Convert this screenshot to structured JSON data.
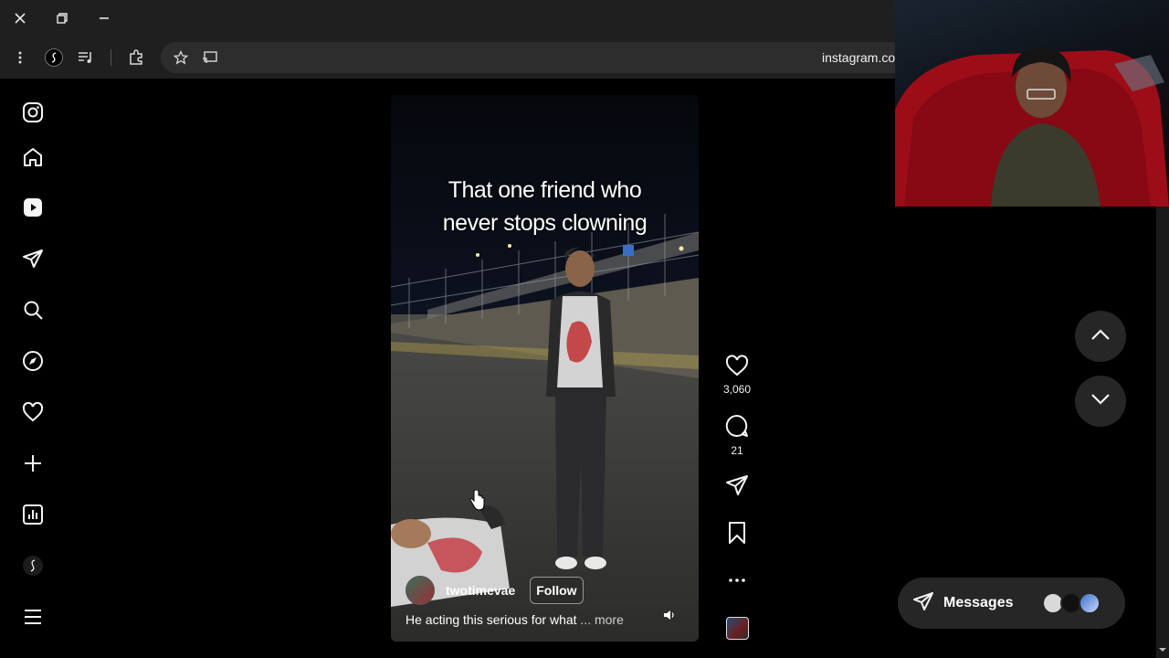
{
  "browser": {
    "url": "instagram.co"
  },
  "reel": {
    "overlay_caption_line1": "That one friend who",
    "overlay_caption_line2": "never stops clowning",
    "username": "twotimevae",
    "follow_label": "Follow",
    "caption": "He acting this serious for what",
    "more_label": "... more"
  },
  "actions": {
    "likes": "3,060",
    "comments": "21"
  },
  "messages": {
    "label": "Messages"
  },
  "icons": {
    "sidebar": [
      "instagram-logo-icon",
      "home-icon",
      "reels-icon",
      "send-icon",
      "search-icon",
      "explore-icon",
      "heart-icon",
      "plus-icon",
      "dashboard-icon",
      "threads-icon",
      "menu-icon"
    ],
    "actions": [
      "heart-icon",
      "comment-icon",
      "share-icon",
      "bookmark-icon",
      "more-icon"
    ]
  },
  "colors": {
    "background": "#000000",
    "browser_chrome": "#1f1f1f",
    "panel": "#262626"
  }
}
